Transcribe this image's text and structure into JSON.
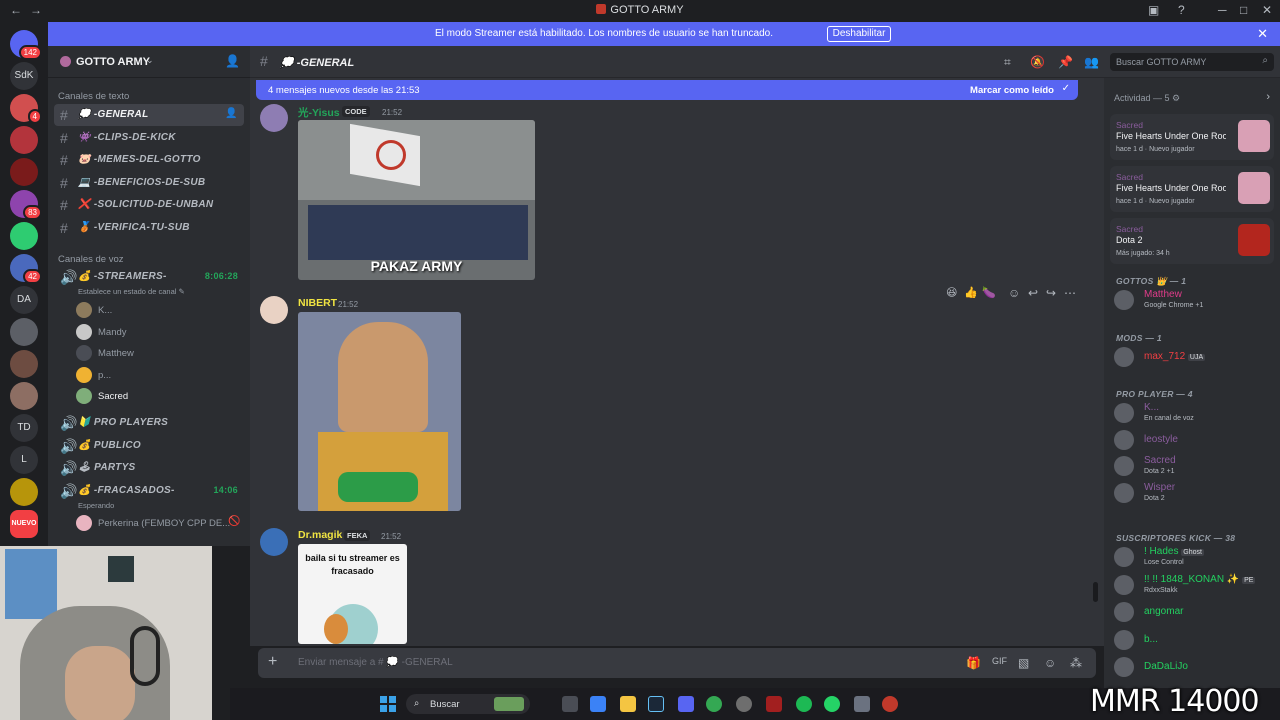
{
  "window": {
    "title": "GOTTO ARMY"
  },
  "banner": {
    "text": "El modo Streamer está habilitado. Los nombres de usuario se han truncado.",
    "button": "Deshabilitar"
  },
  "servers": [
    {
      "label": "",
      "badge": "142"
    },
    {
      "label": "SdK",
      "badge": ""
    },
    {
      "label": "",
      "badge": "4"
    },
    {
      "label": "",
      "badge": ""
    },
    {
      "label": "",
      "badge": ""
    },
    {
      "label": "",
      "badge": "83"
    },
    {
      "label": "",
      "badge": ""
    },
    {
      "label": "",
      "badge": "42"
    },
    {
      "label": "DA",
      "badge": ""
    },
    {
      "label": "",
      "badge": ""
    },
    {
      "label": "",
      "badge": ""
    },
    {
      "label": "",
      "badge": ""
    },
    {
      "label": "TD",
      "badge": ""
    },
    {
      "label": "L",
      "badge": ""
    },
    {
      "label": "",
      "badge": ""
    },
    {
      "label": "NUEVO",
      "badge": ""
    }
  ],
  "guild": {
    "name": "GOTTO ARMY"
  },
  "text_category": "Canales de texto",
  "text_channels": [
    {
      "icon": "💭",
      "name": "-GENERAL"
    },
    {
      "icon": "👾",
      "name": "-CLIPS-DE-KICK"
    },
    {
      "icon": "🐷",
      "name": "-MEMES-DEL-GOTTO"
    },
    {
      "icon": "💻",
      "name": "-BENEFICIOS-DE-SUB"
    },
    {
      "icon": "❌",
      "name": "-SOLICITUD-DE-UNBAN"
    },
    {
      "icon": "🥉",
      "name": "-VERIFICA-TU-SUB"
    }
  ],
  "voice_category": "Canales de voz",
  "voice_streamers": {
    "name": "-STREAMERS-",
    "time": "8:06:28",
    "status": "Establece un estado de canal"
  },
  "voice_users": [
    "K...",
    "Mandy",
    "Matthew",
    "p...",
    "Sacred"
  ],
  "voice_channels": [
    {
      "icon": "🔰",
      "name": "PRO PLAYERS"
    },
    {
      "icon": "💰",
      "name": "PUBLICO"
    },
    {
      "icon": "🕹",
      "name": "PARTYS"
    }
  ],
  "voice_fracasados": {
    "name": "-FRACASADOS-",
    "time": "14:06",
    "status": "Esperando",
    "user": "Perkerina (FEMBOY CPP DE..."
  },
  "topbar": {
    "channel": "💭 -GENERAL",
    "search_placeholder": "Buscar GOTTO ARMY"
  },
  "new_messages": {
    "text": "4 mensajes nuevos desde las 21:53",
    "action": "Marcar como leído"
  },
  "messages": [
    {
      "user": "光-Yisus",
      "tag": "CODE",
      "time": "21:52",
      "image_caption": "PAKAZ ARMY",
      "color": "#23a55a"
    },
    {
      "user": "NIBERT",
      "tag": "",
      "time": "21:52",
      "image_caption": "",
      "color": "#f0e442"
    },
    {
      "user": "Dr.magik",
      "tag": "FEKA",
      "time": "21:52",
      "image_caption": "baila si tu streamer es fracasado",
      "color": "#f0e442"
    }
  ],
  "reactions_bar": [
    "😆",
    "👍",
    "🍆"
  ],
  "composer": {
    "placeholder": "Enviar mensaje a # 💭 -GENERAL"
  },
  "activity": {
    "header": "Actividad — 5",
    "cards": [
      {
        "who": "Sacred",
        "what": "Five Hearts Under One Roof",
        "meta": "hace 1 d  · Nuevo jugador"
      },
      {
        "who": "Sacred",
        "what": "Five Hearts Under One Roo...",
        "meta": "hace 1 d  · Nuevo jugador"
      },
      {
        "who": "Sacred",
        "what": "Dota 2",
        "meta": "Más jugado: 34 h"
      }
    ]
  },
  "member_groups": [
    {
      "title": "GOTTOS 👑 — 1",
      "members": [
        {
          "name": "Matthew",
          "status": "Google Chrome +1",
          "color": "#e03c8a"
        }
      ]
    },
    {
      "title": "MODS — 1",
      "members": [
        {
          "name": "max_712",
          "status": "",
          "color": "#f23f43",
          "tag": "UJA"
        }
      ]
    },
    {
      "title": "PRO PLAYER — 4",
      "members": [
        {
          "name": "K...",
          "status": "En canal de voz",
          "color": "#8b5d9e"
        },
        {
          "name": "leostyle",
          "status": "",
          "color": "#8b5d9e"
        },
        {
          "name": "Sacred",
          "status": "Dota 2 +1",
          "color": "#8b5d9e"
        },
        {
          "name": "Wisper",
          "status": "Dota 2",
          "color": "#8b5d9e"
        }
      ]
    },
    {
      "title": "SUSCRIPTORES KICK — 38",
      "members": [
        {
          "name": "! Hades",
          "status": "Lose Control",
          "color": "#23d160",
          "tag": "Ghost"
        },
        {
          "name": "!! !! 1848_KONAN ✨",
          "status": "RdxxStakk",
          "color": "#23d160",
          "tag": "PE"
        },
        {
          "name": "angomar",
          "status": "",
          "color": "#23d160"
        },
        {
          "name": "b...",
          "status": "",
          "color": "#23d160"
        },
        {
          "name": "DaDaLiJo",
          "status": "",
          "color": "#23d160"
        }
      ]
    }
  ],
  "taskbar": {
    "search": "Buscar"
  },
  "overlay": {
    "mmr": "MMR 14000"
  },
  "colors": {
    "accent": "#5865f2",
    "online": "#23a55a"
  }
}
